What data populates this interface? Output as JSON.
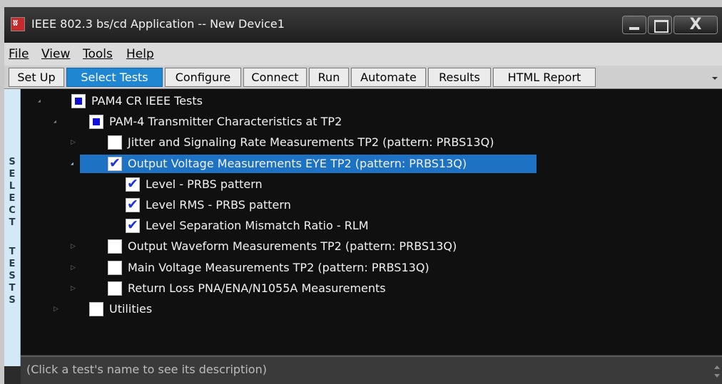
{
  "window": {
    "title": "IEEE 802.3 bs/cd Application -- New Device1"
  },
  "menu": [
    "File",
    "View",
    "Tools",
    "Help"
  ],
  "tabs": [
    {
      "label": "Set Up",
      "active": false
    },
    {
      "label": "Select Tests",
      "active": true
    },
    {
      "label": "Configure",
      "active": false
    },
    {
      "label": "Connect",
      "active": false
    },
    {
      "label": "Run",
      "active": false
    },
    {
      "label": "Automate",
      "active": false
    },
    {
      "label": "Results",
      "active": false
    },
    {
      "label": "HTML Report",
      "active": false
    }
  ],
  "side_label": "SELECT TESTS",
  "tree": [
    {
      "label": "PAM4 CR IEEE Tests",
      "level": 0,
      "check": "partial",
      "expander": "expanded",
      "selected": false
    },
    {
      "label": "PAM-4 Transmitter Characteristics at TP2",
      "level": 1,
      "check": "partial",
      "expander": "expanded",
      "selected": false
    },
    {
      "label": "Jitter and Signaling Rate Measurements TP2 (pattern: PRBS13Q)",
      "level": 2,
      "check": "unchecked",
      "expander": "collapsed",
      "selected": false
    },
    {
      "label": "Output Voltage Measurements EYE TP2 (pattern: PRBS13Q)",
      "level": 2,
      "check": "checked",
      "expander": "expanded",
      "selected": true
    },
    {
      "label": "Level - PRBS pattern",
      "level": 3,
      "check": "checked",
      "expander": "none",
      "selected": false
    },
    {
      "label": "Level RMS - PRBS pattern",
      "level": 3,
      "check": "checked",
      "expander": "none",
      "selected": false
    },
    {
      "label": "Level Separation Mismatch Ratio - RLM",
      "level": 3,
      "check": "checked",
      "expander": "none",
      "selected": false
    },
    {
      "label": "Output Waveform Measurements TP2 (pattern: PRBS13Q)",
      "level": 2,
      "check": "unchecked",
      "expander": "collapsed",
      "selected": false
    },
    {
      "label": "Main Voltage Measurements TP2 (pattern: PRBS13Q)",
      "level": 2,
      "check": "unchecked",
      "expander": "collapsed",
      "selected": false
    },
    {
      "label": "Return Loss PNA/ENA/N1055A Measurements",
      "level": 2,
      "check": "unchecked",
      "expander": "collapsed",
      "selected": false
    },
    {
      "label": "Utilities",
      "level": 1,
      "check": "unchecked",
      "expander": "collapsed",
      "selected": false
    }
  ],
  "description": "(Click a test's name to see its description)",
  "colors": {
    "accent": "#1f86d2",
    "selection": "#1d72c4",
    "checkbox_fill": "#1010d8"
  }
}
